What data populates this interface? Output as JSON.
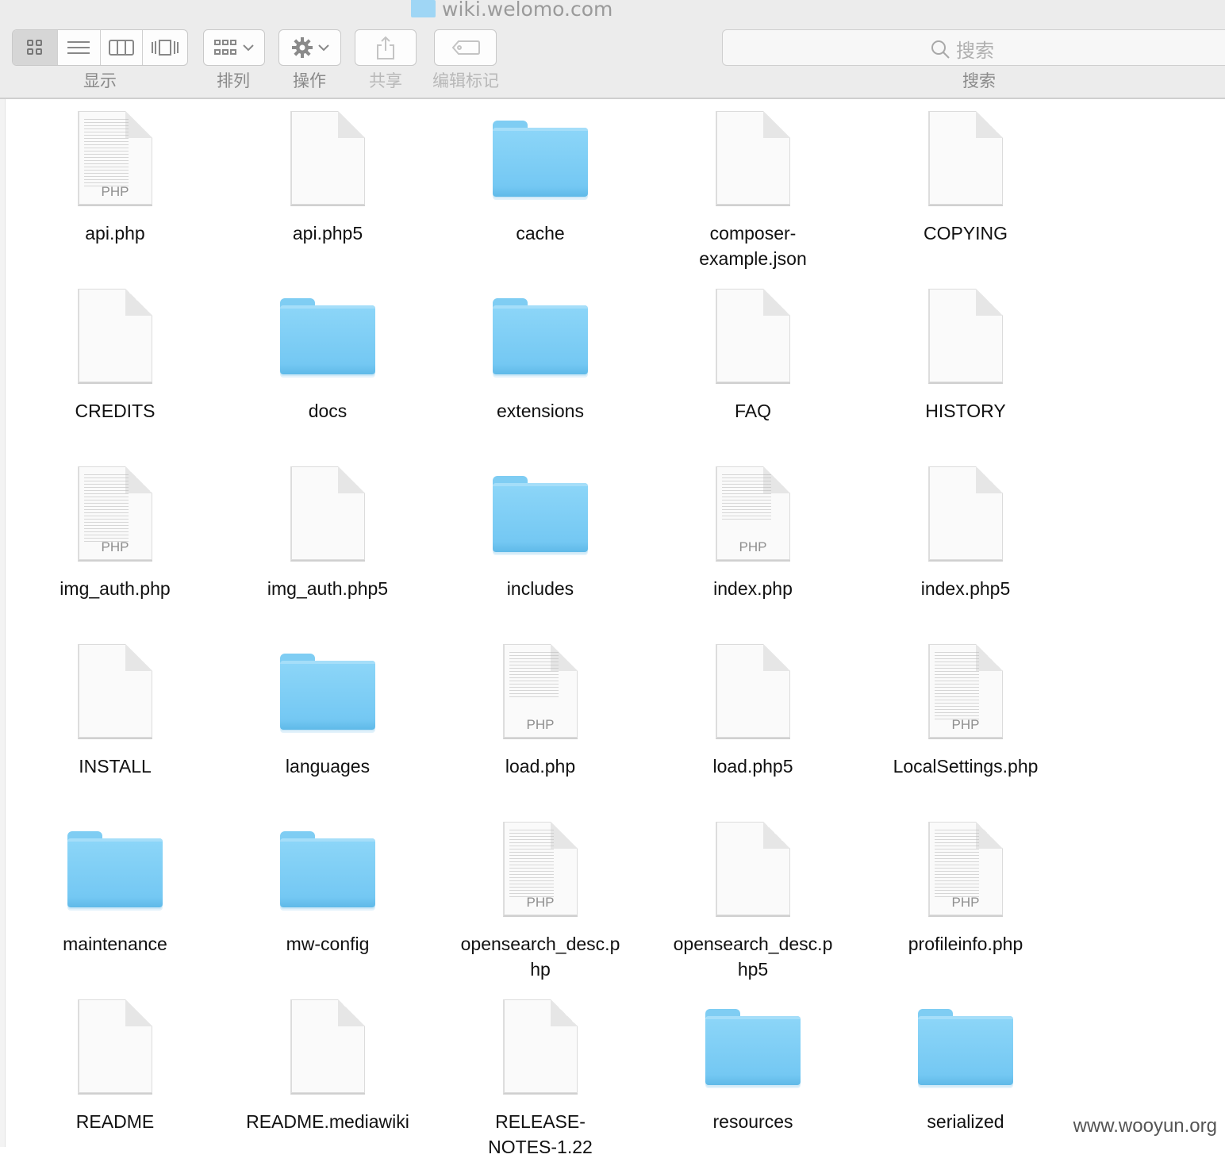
{
  "window": {
    "title": "wiki.welomo.com"
  },
  "toolbar": {
    "view_label": "显示",
    "arrange_label": "排列",
    "action_label": "操作",
    "share_label": "共享",
    "tags_label": "编辑标记",
    "search_placeholder": "搜索",
    "search_label": "搜索"
  },
  "files": [
    {
      "name": "api.php",
      "kind": "php"
    },
    {
      "name": "api.php5",
      "kind": "doc"
    },
    {
      "name": "cache",
      "kind": "folder"
    },
    {
      "name": "composer-\nexample.json",
      "kind": "doc"
    },
    {
      "name": "COPYING",
      "kind": "doc"
    },
    {
      "name": "CREDITS",
      "kind": "doc"
    },
    {
      "name": "docs",
      "kind": "folder"
    },
    {
      "name": "extensions",
      "kind": "folder"
    },
    {
      "name": "FAQ",
      "kind": "doc"
    },
    {
      "name": "HISTORY",
      "kind": "doc"
    },
    {
      "name": "img_auth.php",
      "kind": "php"
    },
    {
      "name": "img_auth.php5",
      "kind": "doc"
    },
    {
      "name": "includes",
      "kind": "folder"
    },
    {
      "name": "index.php",
      "kind": "php-short"
    },
    {
      "name": "index.php5",
      "kind": "doc"
    },
    {
      "name": "INSTALL",
      "kind": "doc"
    },
    {
      "name": "languages",
      "kind": "folder"
    },
    {
      "name": "load.php",
      "kind": "php-short"
    },
    {
      "name": "load.php5",
      "kind": "doc"
    },
    {
      "name": "LocalSettings.php",
      "kind": "php"
    },
    {
      "name": "maintenance",
      "kind": "folder"
    },
    {
      "name": "mw-config",
      "kind": "folder"
    },
    {
      "name": "opensearch_desc.p\nhp",
      "kind": "php"
    },
    {
      "name": "opensearch_desc.p\nhp5",
      "kind": "doc"
    },
    {
      "name": "profileinfo.php",
      "kind": "php"
    },
    {
      "name": "README",
      "kind": "doc"
    },
    {
      "name": "README.mediawiki",
      "kind": "doc"
    },
    {
      "name": "RELEASE-\nNOTES-1.22",
      "kind": "doc"
    },
    {
      "name": "resources",
      "kind": "folder"
    },
    {
      "name": "serialized",
      "kind": "folder"
    }
  ],
  "php_tag": "PHP",
  "watermark": "www.wooyun.org"
}
